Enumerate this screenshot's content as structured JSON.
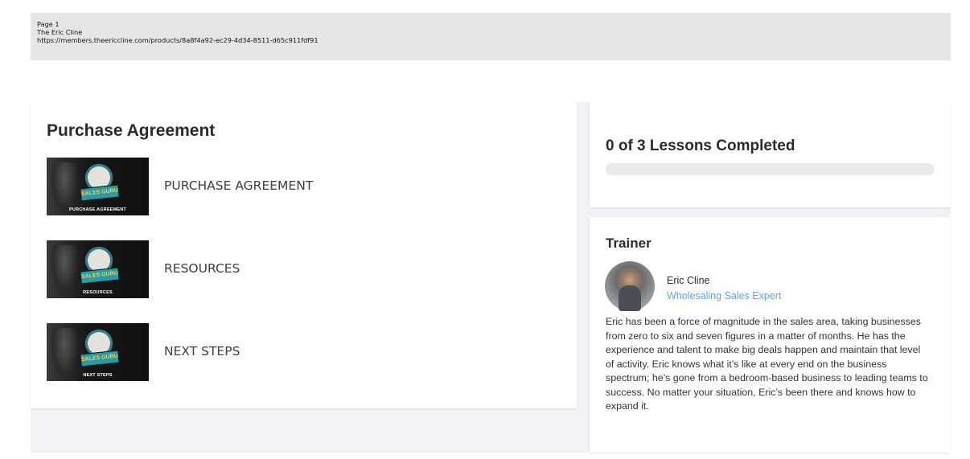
{
  "print_header": {
    "page": "Page 1",
    "site": "The Eric Cline",
    "url": "https://members.theericcline.com/products/8a8f4a92-ec29-4d34-8511-d65c911fdf91"
  },
  "course": {
    "title": "Purchase Agreement",
    "lessons": [
      {
        "label": "PURCHASE AGREEMENT",
        "thumb_logo": "SALES GURU",
        "thumb_caption": "PURCHASE AGREEMENT"
      },
      {
        "label": "RESOURCES",
        "thumb_logo": "SALES GURU",
        "thumb_caption": "RESOURCES"
      },
      {
        "label": "NEXT STEPS",
        "thumb_logo": "SALES GURU",
        "thumb_caption": "NEXT STEPS"
      }
    ]
  },
  "progress": {
    "title": "0 of 3 Lessons Completed",
    "completed": 0,
    "total": 3
  },
  "trainer": {
    "title": "Trainer",
    "name": "Eric Cline",
    "role": "Wholesaling Sales Expert",
    "bio": "Eric has been a force of magnitude in the sales area, taking businesses from zero to six and seven figures in a matter of months. He has the experience and talent to make big deals happen and maintain that level of activity. Eric knows what it’s like at every end on the business spectrum; he’s gone from a bedroom-based business to leading teams to success. No matter your situation, Eric’s been there and knows how to expand it."
  },
  "colors": {
    "accent": "#5aa8e6",
    "progress_track": "#e9ecef",
    "page_background": "#f0f2f5"
  }
}
